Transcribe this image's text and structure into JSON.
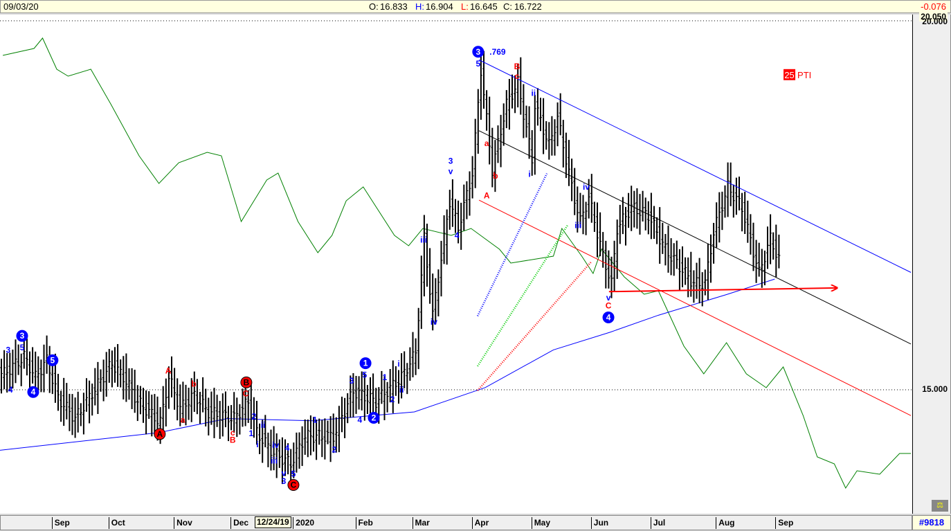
{
  "header": {
    "date": "09/03/20",
    "open_label": "O:",
    "open": "16.833",
    "high_label": "H:",
    "high": "16.904",
    "low_label": "L:",
    "low": "16.645",
    "close_label": "C:",
    "close": "16.722",
    "change": "-0.076"
  },
  "price_axis": {
    "top_label": "20.000",
    "top_overlay": "20.050",
    "mid_label": "15.000"
  },
  "time_axis": {
    "months": [
      {
        "label": "Sep",
        "idx": 18
      },
      {
        "label": "Oct",
        "idx": 38
      },
      {
        "label": "Nov",
        "idx": 61
      },
      {
        "label": "Dec",
        "idx": 81
      },
      {
        "label": "2020",
        "idx": 103
      },
      {
        "label": "Feb",
        "idx": 125
      },
      {
        "label": "Mar",
        "idx": 145
      },
      {
        "label": "Apr",
        "idx": 166
      },
      {
        "label": "May",
        "idx": 187
      },
      {
        "label": "Jun",
        "idx": 208
      },
      {
        "label": "Jul",
        "idx": 229
      },
      {
        "label": "Aug",
        "idx": 252
      },
      {
        "label": "Sep",
        "idx": 273
      }
    ],
    "cursor_date": "12/24/19"
  },
  "footer": {
    "count": "#9818"
  },
  "chart_data": {
    "type": "ohlc-bar",
    "x_unit": "trading day index",
    "xlim": [
      0,
      321
    ],
    "ylim": [
      13.3,
      20.05
    ],
    "price_path": [
      [
        1,
        15.22
      ],
      [
        8,
        15.45
      ],
      [
        12,
        15.17
      ],
      [
        16,
        15.4
      ],
      [
        20,
        14.89
      ],
      [
        26,
        14.61
      ],
      [
        30,
        14.84
      ],
      [
        39,
        15.36
      ],
      [
        44,
        15.12
      ],
      [
        48,
        14.84
      ],
      [
        56,
        14.56
      ],
      [
        59,
        15.17
      ],
      [
        63,
        14.75
      ],
      [
        68,
        14.93
      ],
      [
        73,
        14.7
      ],
      [
        82,
        14.61
      ],
      [
        87,
        14.84
      ],
      [
        90,
        14.42
      ],
      [
        96,
        14.14
      ],
      [
        102,
        14.0
      ],
      [
        107,
        14.37
      ],
      [
        117,
        14.37
      ],
      [
        124,
        14.98
      ],
      [
        132,
        14.84
      ],
      [
        141,
        15.17
      ],
      [
        146,
        15.5
      ],
      [
        149,
        17.05
      ],
      [
        152,
        16.01
      ],
      [
        158,
        17.56
      ],
      [
        161,
        17.19
      ],
      [
        166,
        17.94
      ],
      [
        169,
        19.34
      ],
      [
        173,
        17.98
      ],
      [
        178,
        18.87
      ],
      [
        182,
        19.16
      ],
      [
        187,
        18.12
      ],
      [
        188,
        18.87
      ],
      [
        193,
        18.31
      ],
      [
        196,
        18.69
      ],
      [
        201,
        17.75
      ],
      [
        204,
        17.28
      ],
      [
        207,
        17.61
      ],
      [
        212,
        16.81
      ],
      [
        215,
        16.44
      ],
      [
        217,
        17.19
      ],
      [
        222,
        17.47
      ],
      [
        228,
        17.37
      ],
      [
        234,
        16.9
      ],
      [
        244,
        16.44
      ],
      [
        248,
        16.44
      ],
      [
        251,
        17.14
      ],
      [
        256,
        17.75
      ],
      [
        261,
        17.47
      ],
      [
        267,
        16.58
      ],
      [
        271,
        17.05
      ],
      [
        274,
        16.76
      ]
    ],
    "moving_average": [
      [
        0,
        14.18
      ],
      [
        56,
        14.42
      ],
      [
        80,
        14.61
      ],
      [
        110,
        14.58
      ],
      [
        146,
        14.7
      ],
      [
        171,
        15.03
      ],
      [
        195,
        15.54
      ],
      [
        215,
        15.78
      ],
      [
        232,
        16.01
      ],
      [
        256,
        16.29
      ],
      [
        273,
        16.5
      ]
    ],
    "relative_strength": {
      "ylim": [
        0,
        740
      ],
      "points": [
        [
          1,
          660
        ],
        [
          12,
          670
        ],
        [
          15,
          685
        ],
        [
          20,
          640
        ],
        [
          24,
          630
        ],
        [
          32,
          640
        ],
        [
          39,
          590
        ],
        [
          49,
          515
        ],
        [
          56,
          475
        ],
        [
          63,
          505
        ],
        [
          73,
          520
        ],
        [
          78,
          515
        ],
        [
          85,
          420
        ],
        [
          94,
          480
        ],
        [
          98,
          490
        ],
        [
          105,
          420
        ],
        [
          112,
          375
        ],
        [
          117,
          400
        ],
        [
          122,
          450
        ],
        [
          128,
          470
        ],
        [
          139,
          400
        ],
        [
          144,
          385
        ],
        [
          149,
          410
        ],
        [
          159,
          400
        ],
        [
          166,
          410
        ],
        [
          176,
          380
        ],
        [
          180,
          360
        ],
        [
          195,
          370
        ],
        [
          198,
          410
        ],
        [
          205,
          370
        ],
        [
          209,
          345
        ],
        [
          212,
          380
        ],
        [
          220,
          340
        ],
        [
          227,
          315
        ],
        [
          232,
          320
        ],
        [
          241,
          240
        ],
        [
          248,
          200
        ],
        [
          256,
          245
        ],
        [
          263,
          200
        ],
        [
          270,
          180
        ],
        [
          276,
          210
        ],
        [
          283,
          140
        ],
        [
          288,
          80
        ],
        [
          294,
          70
        ],
        [
          298,
          35
        ],
        [
          302,
          60
        ],
        [
          310,
          55
        ],
        [
          317,
          85
        ],
        [
          321,
          85
        ]
      ]
    },
    "trendlines": [
      {
        "color": "#0000ff",
        "from": [
          168.8,
          19.47
        ],
        "to": [
          321,
          16.59
        ]
      },
      {
        "color": "#000000",
        "from": [
          168.8,
          18.51
        ],
        "to": [
          321,
          15.62
        ]
      },
      {
        "color": "#ff0000",
        "from": [
          168.8,
          17.57
        ],
        "to": [
          321,
          14.65
        ]
      },
      {
        "color": "#ff0000",
        "from": [
          214.6,
          16.33
        ],
        "to": [
          295,
          16.38
        ],
        "arrow": true,
        "width": 2.5
      },
      {
        "color": "#0000ff",
        "from": [
          168.3,
          16.0
        ],
        "to": [
          192.7,
          17.93
        ],
        "dotted": true
      },
      {
        "color": "#00cc00",
        "from": [
          168.3,
          15.32
        ],
        "to": [
          200,
          17.23
        ],
        "dotted": true
      },
      {
        "color": "#ff0000",
        "from": [
          168.3,
          14.99
        ],
        "to": [
          208.5,
          16.74
        ],
        "dotted": true
      }
    ],
    "wave_labels": [
      {
        "t": "3",
        "c": "blue",
        "x": 7.8,
        "y": 15.73,
        "circle": true
      },
      {
        "t": "4",
        "c": "blue",
        "x": 11.7,
        "y": 14.97,
        "circle": true
      },
      {
        "t": "5",
        "c": "blue",
        "x": 18.5,
        "y": 15.4,
        "circle": true
      },
      {
        "t": "1",
        "c": "blue",
        "x": 128.8,
        "y": 15.36,
        "circle": true
      },
      {
        "t": "2",
        "c": "blue",
        "x": 131.7,
        "y": 14.62,
        "circle": true
      },
      {
        "t": "3",
        "c": "blue",
        "x": 168.5,
        "y": 19.58,
        "circle": true
      },
      {
        "t": "4",
        "c": "blue",
        "x": 214.4,
        "y": 15.98,
        "circle": true
      },
      {
        "t": "A",
        "c": "red",
        "x": 56.3,
        "y": 14.4,
        "circle": true
      },
      {
        "t": "B",
        "c": "red",
        "x": 86.8,
        "y": 15.1,
        "circle": true
      },
      {
        "t": "C",
        "c": "red",
        "x": 103.4,
        "y": 13.71,
        "circle": true
      },
      {
        "t": ".769",
        "c": "blue",
        "x": 172.5,
        "y": 19.58
      },
      {
        "t": "3",
        "c": "blue",
        "x": 2.9,
        "y": 15.54
      },
      {
        "t": "5",
        "c": "blue",
        "x": 7.8,
        "y": 15.57
      },
      {
        "t": "4",
        "c": "blue",
        "x": 3.7,
        "y": 15.0
      },
      {
        "t": "A",
        "c": "red",
        "x": 59.3,
        "y": 15.26
      },
      {
        "t": "b",
        "c": "red",
        "x": 68.3,
        "y": 15.08
      },
      {
        "t": "a",
        "c": "red",
        "x": 64.4,
        "y": 14.59
      },
      {
        "t": "C",
        "c": "red",
        "x": 86.6,
        "y": 14.95
      },
      {
        "t": "c",
        "c": "red",
        "x": 82,
        "y": 14.42
      },
      {
        "t": "B",
        "c": "red",
        "x": 82,
        "y": 14.32
      },
      {
        "t": "2",
        "c": "blue",
        "x": 89.5,
        "y": 14.64
      },
      {
        "t": "1",
        "c": "blue",
        "x": 88.5,
        "y": 14.41
      },
      {
        "t": "ii",
        "c": "blue",
        "x": 92.7,
        "y": 14.52
      },
      {
        "t": "i",
        "c": "blue",
        "x": 90.7,
        "y": 14.26
      },
      {
        "t": "iv",
        "c": "blue",
        "x": 97.1,
        "y": 14.25
      },
      {
        "t": "4",
        "c": "blue",
        "x": 101.2,
        "y": 14.21
      },
      {
        "t": "iii",
        "c": "blue",
        "x": 96.6,
        "y": 14.04
      },
      {
        "t": "v",
        "c": "blue",
        "x": 100,
        "y": 13.87
      },
      {
        "t": "5",
        "c": "blue",
        "x": 103.4,
        "y": 13.86
      },
      {
        "t": "3",
        "c": "blue",
        "x": 100,
        "y": 13.76
      },
      {
        "t": "1",
        "c": "blue",
        "x": 111,
        "y": 14.59
      },
      {
        "t": "2",
        "c": "blue",
        "x": 117.8,
        "y": 14.19
      },
      {
        "t": "3",
        "c": "blue",
        "x": 123.9,
        "y": 15.12
      },
      {
        "t": "5",
        "c": "blue",
        "x": 128.5,
        "y": 15.2
      },
      {
        "t": "4",
        "c": "blue",
        "x": 126.8,
        "y": 14.59
      },
      {
        "t": "1",
        "c": "blue",
        "x": 135.6,
        "y": 15.17
      },
      {
        "t": "2",
        "c": "blue",
        "x": 138.3,
        "y": 14.87
      },
      {
        "t": "i",
        "c": "blue",
        "x": 140.5,
        "y": 15.35
      },
      {
        "t": "ii",
        "c": "blue",
        "x": 141.5,
        "y": 15.0
      },
      {
        "t": "iii",
        "c": "blue",
        "x": 149.3,
        "y": 17.03
      },
      {
        "t": "iv",
        "c": "blue",
        "x": 152.9,
        "y": 15.92
      },
      {
        "t": "3",
        "c": "blue",
        "x": 158.8,
        "y": 18.1
      },
      {
        "t": "v",
        "c": "blue",
        "x": 158.8,
        "y": 17.96
      },
      {
        "t": "4",
        "c": "blue",
        "x": 161,
        "y": 17.09
      },
      {
        "t": "5",
        "c": "blue",
        "x": 168.5,
        "y": 19.42
      },
      {
        "t": "a",
        "c": "red",
        "x": 171.5,
        "y": 18.34
      },
      {
        "t": "b",
        "c": "red",
        "x": 174.6,
        "y": 17.9
      },
      {
        "t": "B",
        "c": "red",
        "x": 182.2,
        "y": 19.38
      },
      {
        "t": "c",
        "c": "red",
        "x": 182.2,
        "y": 19.25
      },
      {
        "t": "ii",
        "c": "blue",
        "x": 188,
        "y": 19.02
      },
      {
        "t": "i",
        "c": "blue",
        "x": 186.6,
        "y": 17.92
      },
      {
        "t": "iv",
        "c": "blue",
        "x": 206.6,
        "y": 17.75
      },
      {
        "t": "iii",
        "c": "blue",
        "x": 203.7,
        "y": 17.23
      },
      {
        "t": "A",
        "c": "red",
        "x": 171.5,
        "y": 17.63
      },
      {
        "t": "v",
        "c": "blue",
        "x": 214.4,
        "y": 16.25
      },
      {
        "t": "C",
        "c": "red",
        "x": 214.4,
        "y": 16.14
      }
    ],
    "badge": {
      "number": "25",
      "text": "PTI",
      "x": 280.5,
      "y": 19.27,
      "color": "#ff0000"
    }
  }
}
